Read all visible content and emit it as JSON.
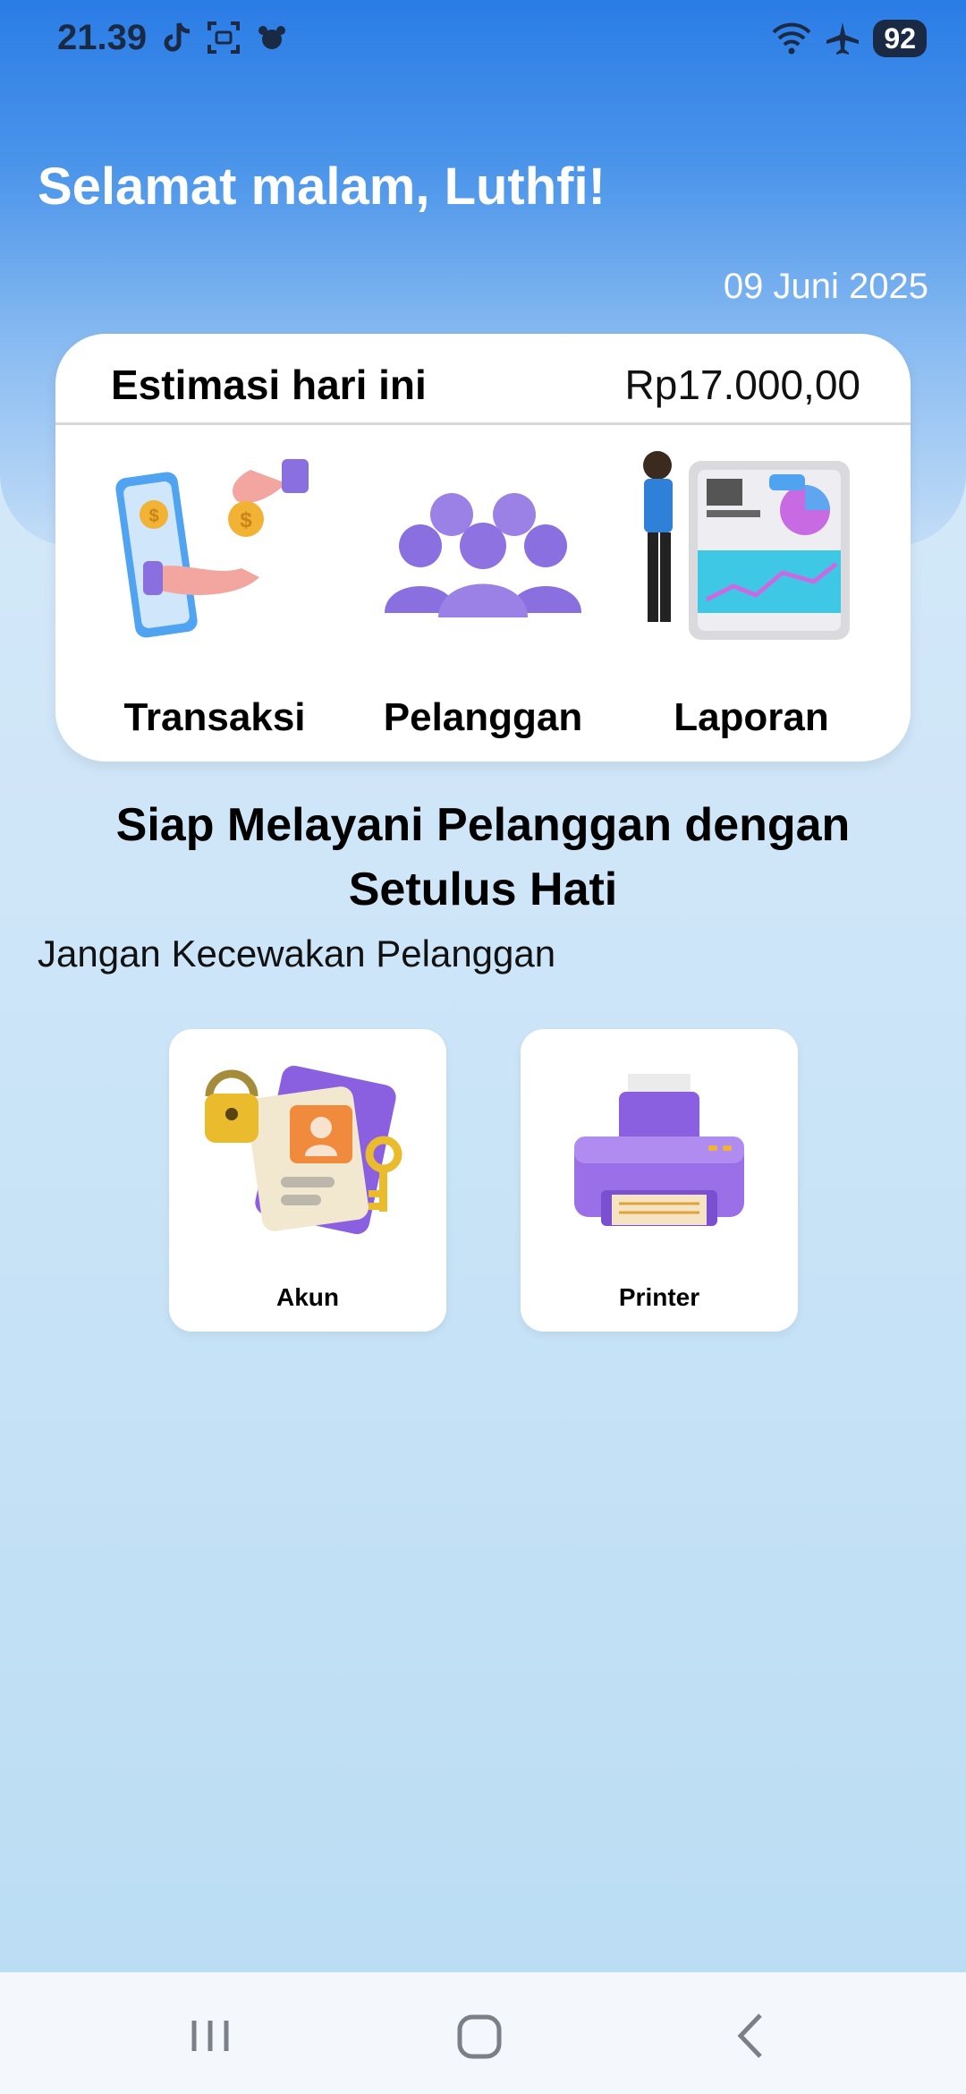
{
  "status_bar": {
    "time": "21.39",
    "battery": "92",
    "left_icons": [
      "tiktok-icon",
      "screenshot-icon",
      "notification-icon"
    ],
    "right_icons": [
      "wifi-icon",
      "airplane-icon"
    ]
  },
  "header": {
    "greeting": "Selamat malam, Luthfi!",
    "date": "09 Juni 2025"
  },
  "estimate_card": {
    "label": "Estimasi hari ini",
    "value": "Rp17.000,00",
    "menu": [
      {
        "label": "Transaksi",
        "icon": "payment-hand-icon"
      },
      {
        "label": "Pelanggan",
        "icon": "customers-group-icon"
      },
      {
        "label": "Laporan",
        "icon": "report-chart-icon"
      }
    ]
  },
  "headline": "Siap Melayani Pelanggan dengan Setulus Hati",
  "subline": "Jangan Kecewakan Pelanggan",
  "tiles": [
    {
      "label": "Akun",
      "icon": "account-lock-icon"
    },
    {
      "label": "Printer",
      "icon": "printer-icon"
    }
  ],
  "colors": {
    "header_blue": "#2a7ce6",
    "accent_purple": "#8c6ee0",
    "background": "#cfe6f8"
  },
  "navbar": {
    "buttons": [
      "recent-apps",
      "home",
      "back"
    ]
  }
}
